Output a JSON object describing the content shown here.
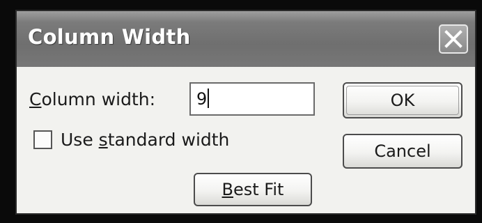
{
  "dialog": {
    "title": "Column Width",
    "close_icon": "close-x-icon"
  },
  "form": {
    "column_width_label_prefix": "C",
    "column_width_label_rest": "olumn width:",
    "column_width_value": "9",
    "use_standard_label_prefix": "Use ",
    "use_standard_label_accel": "s",
    "use_standard_label_rest": "tandard width",
    "use_standard_checked": false
  },
  "buttons": {
    "ok": "OK",
    "cancel": "Cancel",
    "best_fit_accel": "B",
    "best_fit_rest": "est Fit"
  }
}
